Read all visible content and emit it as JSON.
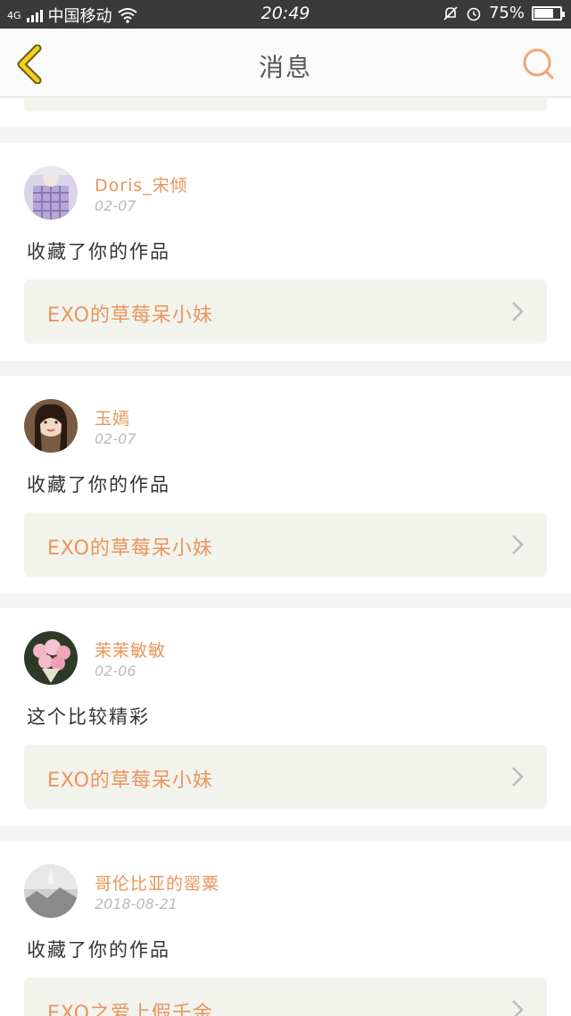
{
  "status": {
    "network": "4G",
    "carrier": "中国移动",
    "time": "20:49",
    "battery": "75%",
    "battery_level": 0.75
  },
  "header": {
    "title": "消息",
    "back_icon": "chevron-left-icon",
    "search_icon": "search-icon"
  },
  "colors": {
    "accent": "#e8955a",
    "card_bg": "#f3f3ee",
    "back_icon": "#f0d020"
  },
  "messages": [
    {
      "user": "Doris_宋倾",
      "date": "02-07",
      "action": "收藏了你的作品",
      "work": "EXO的草莓呆小妹"
    },
    {
      "user": "玉嫣",
      "date": "02-07",
      "action": "收藏了你的作品",
      "work": "EXO的草莓呆小妹"
    },
    {
      "user": "茉茉敏敏",
      "date": "02-06",
      "action": "这个比较精彩",
      "work": "EXO的草莓呆小妹"
    },
    {
      "user": "哥伦比亚的罂粟",
      "date": "2018-08-21",
      "action": "收藏了你的作品",
      "work": "EXO之爱上假千金"
    }
  ]
}
